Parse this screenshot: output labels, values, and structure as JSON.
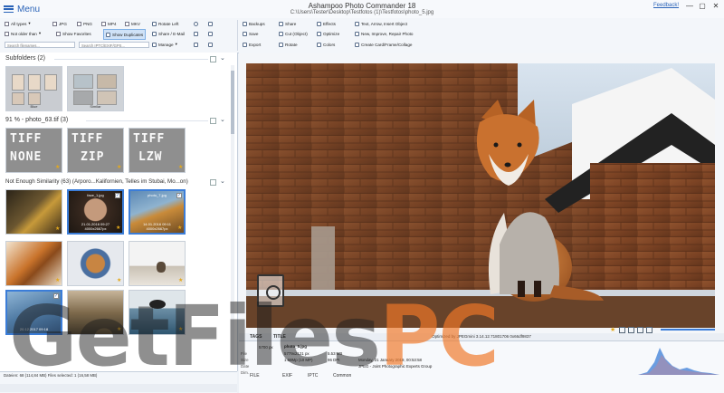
{
  "app": {
    "title": "Ashampoo Photo Commander 18",
    "path": "C:\\Users\\Tester\\Desktop\\Testfotos (1)\\Testfotos\\photo_5.jpg",
    "menu_label": "Menu",
    "feedback_label": "Feedback!",
    "window_controls": [
      "—",
      "▢",
      "✕"
    ]
  },
  "ribbon": {
    "all_types": "All types",
    "types": [
      "JPG",
      "PNG",
      "MP4",
      "MKV"
    ],
    "not_older_than": "Not older than",
    "show_favorites": "Show Favorites",
    "show_duplicates": "Show Duplicates",
    "search_filenames_placeholder": "Search filenames...",
    "search_iptc_placeholder": "Search IPTC/EXIF/GPS...",
    "rotate_left": "Rotate Left",
    "share_email": "Share / E-Mail",
    "manage": "Manage",
    "backups": "Backups",
    "save": "Save",
    "export": "Export",
    "share": "Share",
    "cut_object": "Cut (Object)",
    "rotate": "Rotate",
    "effects": "Effects",
    "optimize": "Optimize",
    "colors": "Colors",
    "text_arrow": "Text, Arrow, Insert Object",
    "new_improve": "New, Improve, Repair Photo",
    "create_card": "Create Card/Frame/Collage"
  },
  "groups": {
    "subfolders": "Subfolders  (2)",
    "subfolder_items": [
      "Blue",
      "Similar"
    ],
    "tiff_group": "91 %  - photo_63.tif   (3)",
    "tiff_words": [
      "TIFF NONE",
      "TIFF ZIP",
      "TIFF LZW"
    ],
    "similar_group": "Not Enough Similarity   (63)   (Arporo...Kalifornien, Telles im Stubai, Mo...on)",
    "selected_thumbs": [
      {
        "name": "face_1.jpg",
        "date": "21.01.2016 09:27",
        "size": "4000x2667px"
      },
      {
        "name": "photo_7.jpg",
        "date": "14.01.2016 09:11",
        "size": "4000x2667px"
      }
    ],
    "bottom_thumb": "20.12.2017 09:18"
  },
  "status": {
    "text": "Dateien: 68 (114,84 MB)   Files selected: 1 (16,58 MB)"
  },
  "viewer": {
    "optimized_text": "Optimized by JPEGmini 3.14.12.71801706 0x66df9837"
  },
  "info": {
    "tabs": [
      "TAGS",
      "TITLE",
      "FILE",
      "EXIF",
      "IPTC",
      "Common"
    ],
    "filename": "photo_5.jpg",
    "keys": [
      "File",
      "Size",
      "Date",
      "Dim."
    ],
    "vals": [
      "5700 px",
      "5.53 MB",
      "Monday, 21 January 2019, 00:53:58",
      "96 DPI"
    ],
    "image_size": "5779x2121 px",
    "megapixel": "1.68Mp (10 MP)",
    "format": "JPEG - Joint Photographic Experts Group"
  },
  "watermark": {
    "part1": "GetFiles",
    "part2": "PC"
  },
  "colors": {
    "accent": "#2a63b8",
    "selection": "#3b7dd8"
  }
}
